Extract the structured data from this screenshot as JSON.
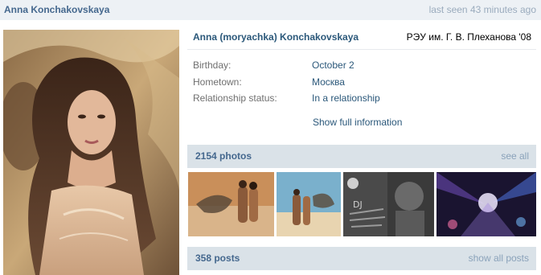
{
  "header": {
    "name": "Anna Konchakovskaya",
    "last_seen": "last seen 43 minutes ago"
  },
  "profile": {
    "full_name": "Anna (moryachka) Konchakovskaya",
    "school": "РЭУ им. Г. В. Плеханова '08",
    "fields": [
      {
        "label": "Birthday:",
        "value": "October 2"
      },
      {
        "label": "Hometown:",
        "value": "Москва"
      },
      {
        "label": "Relationship status:",
        "value": "In a relationship"
      }
    ],
    "show_full": "Show full information"
  },
  "photos": {
    "title": "2154 photos",
    "see_all": "see all",
    "thumbs": [
      {
        "name": "photo-thumb-beach-couple"
      },
      {
        "name": "photo-thumb-beach-sky"
      },
      {
        "name": "photo-thumb-dj-poster",
        "text": "DJ"
      },
      {
        "name": "photo-thumb-club-lights"
      }
    ]
  },
  "posts": {
    "title": "358 posts",
    "show_all": "show all posts"
  },
  "colors": {
    "link": "#2b587a",
    "header_bg": "#edf1f5",
    "section_bg": "#dae2e8"
  }
}
